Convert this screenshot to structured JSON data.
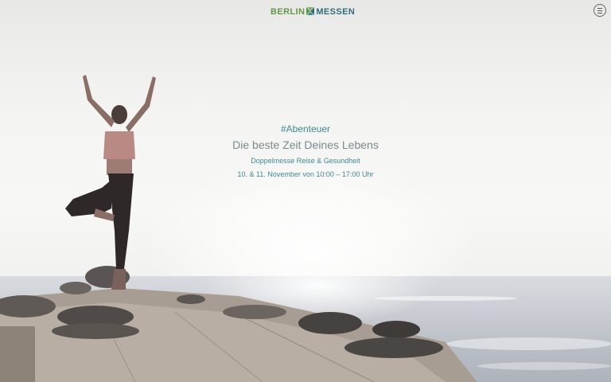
{
  "header": {
    "logo_part1": "BERLIN",
    "logo_part2": "MESSEN",
    "logo_colors": {
      "berlin": "#5f9a48",
      "messen": "#2f6f76"
    },
    "menu_icon": "hamburger-menu-icon"
  },
  "hero": {
    "tag": "#Abenteuer",
    "title": "Die beste Zeit Deines Lebens",
    "subtitle": "Doppelmesse Reise & Gesundheit",
    "date": "10. & 11. November von 10:00 – 17:00 Uhr",
    "text_color": "#3f8a93"
  }
}
